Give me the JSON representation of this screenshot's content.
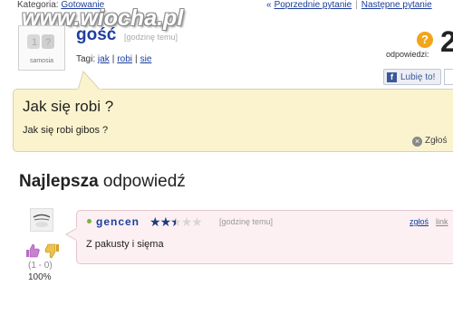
{
  "topbar": {
    "category_label": "Kategoria:",
    "category_link": "Gotowanie",
    "prev_link": "Poprzednie pytanie",
    "next_link": "Następne pytanie"
  },
  "watermark": "www.wiocha.pl",
  "asker": {
    "avatar_text": "samosia",
    "name": "gość",
    "time": "[godzinę temu]",
    "tags_label": "Tagi:",
    "tags": [
      "jak",
      "robi",
      "sie"
    ]
  },
  "answers_box": {
    "icon_glyph": "?",
    "label": "odpowiedzi:",
    "count": "2"
  },
  "like_button": {
    "icon_text": "f",
    "label": "Lubię to!"
  },
  "question": {
    "title": "Jak się robi ?",
    "body": "Jak się robi gibos ?",
    "report_label": "Zgłoś"
  },
  "best_answer": {
    "heading_bold": "Najlepsza",
    "heading_rest": " odpowiedź",
    "user": "gencen",
    "rating": 2.5,
    "rating_max": 5,
    "time": "[godzinę temu]",
    "report_label": "zgłoś",
    "link_label": "link",
    "body": "Z pakusty i sięma",
    "votes": "(1 - 0)",
    "percent": "100%"
  },
  "icons": {
    "answers": "question-mark-icon",
    "report": "close-circle-icon",
    "thumb_up": "thumb-up-icon",
    "thumb_down": "thumb-down-icon",
    "star": "star-icon"
  },
  "colors": {
    "link": "#1a3d9a",
    "username": "#1f3ea0",
    "question_bg": "#fbf3cd",
    "answer_bg": "#fdf0f3",
    "answers_icon": "#f2a51a"
  }
}
